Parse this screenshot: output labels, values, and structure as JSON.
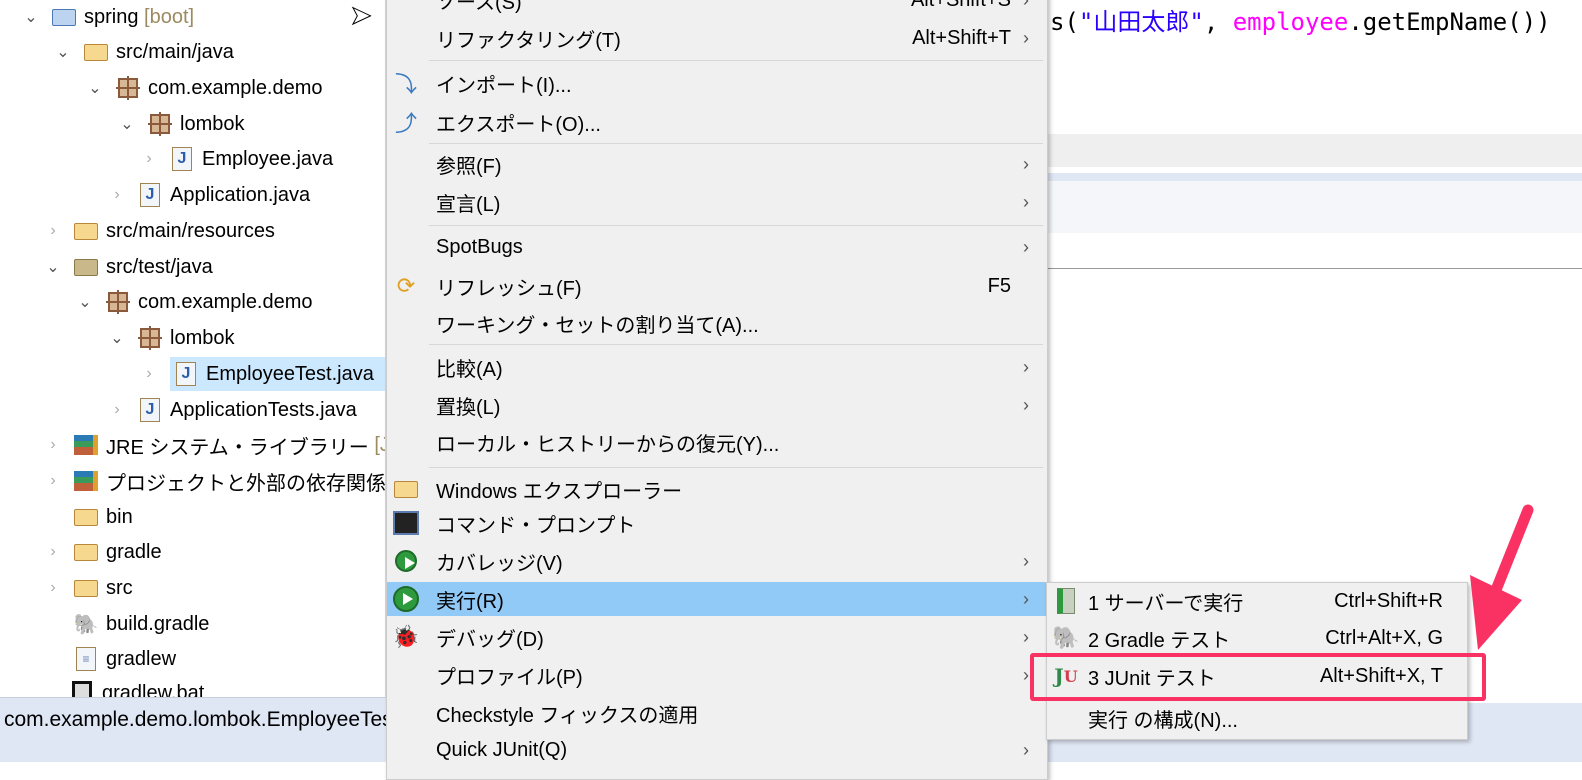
{
  "tree": {
    "items": [
      {
        "label": "spring",
        "suffix": "[boot]"
      },
      {
        "label": "src/main/java"
      },
      {
        "label": "com.example.demo"
      },
      {
        "label": "lombok"
      },
      {
        "label": "Employee.java"
      },
      {
        "label": "Application.java"
      },
      {
        "label": "src/main/resources"
      },
      {
        "label": "src/test/java"
      },
      {
        "label": "com.example.demo"
      },
      {
        "label": "lombok"
      },
      {
        "label": "EmployeeTest.java"
      },
      {
        "label": "ApplicationTests.java"
      },
      {
        "label": "JRE システム・ライブラリー",
        "suffix": "[Java"
      },
      {
        "label": "プロジェクトと外部の依存関係"
      },
      {
        "label": "bin"
      },
      {
        "label": "gradle"
      },
      {
        "label": "src"
      },
      {
        "label": "build.gradle"
      },
      {
        "label": "gradlew"
      },
      {
        "label": "gradlew.bat"
      }
    ]
  },
  "status": {
    "text": "com.example.demo.lombok.EmployeeTest"
  },
  "editor": {
    "code_prefix": "s(",
    "code_string": "\"山田太郎\"",
    "code_sep": ", ",
    "code_field": "employee",
    "code_rest": ".getEmpName())"
  },
  "menu": {
    "items": [
      {
        "label": "ソース(S)",
        "shortcut": "Alt+Shift+S"
      },
      {
        "label": "リファクタリング(T)",
        "shortcut": "Alt+Shift+T"
      },
      {
        "label": "インポート(I)..."
      },
      {
        "label": "エクスポート(O)..."
      },
      {
        "label": "参照(F)"
      },
      {
        "label": "宣言(L)"
      },
      {
        "label": "SpotBugs"
      },
      {
        "label": "リフレッシュ(F)",
        "shortcut": "F5"
      },
      {
        "label": "ワーキング・セットの割り当て(A)..."
      },
      {
        "label": "比較(A)"
      },
      {
        "label": "置換(L)"
      },
      {
        "label": "ローカル・ヒストリーからの復元(Y)..."
      },
      {
        "label": "Windows エクスプローラー"
      },
      {
        "label": "コマンド・プロンプト"
      },
      {
        "label": "カバレッジ(V)"
      },
      {
        "label": "実行(R)"
      },
      {
        "label": "デバッグ(D)"
      },
      {
        "label": "プロファイル(P)"
      },
      {
        "label": "Checkstyle フィックスの適用"
      },
      {
        "label": "Quick JUnit(Q)"
      }
    ]
  },
  "submenu": {
    "items": [
      {
        "label": "1 サーバーで実行",
        "shortcut": "Ctrl+Shift+R"
      },
      {
        "label": "2 Gradle テスト",
        "shortcut": "Ctrl+Alt+X, G"
      },
      {
        "label": "3 JUnit テスト",
        "shortcut": "Alt+Shift+X, T"
      },
      {
        "label": "実行 の構成(N)..."
      }
    ]
  },
  "colors": {
    "highlight": "#91c9f7",
    "annotation": "#fa3264",
    "selection": "#cce8ff"
  }
}
